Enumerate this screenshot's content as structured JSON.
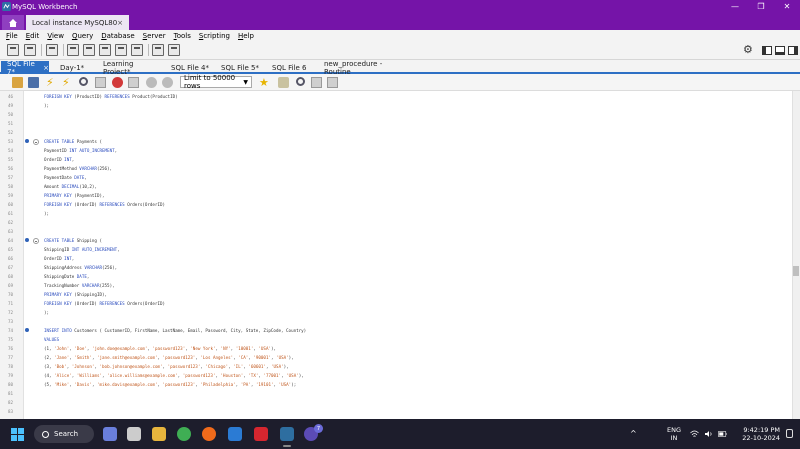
{
  "window": {
    "title": "MySQL Workbench",
    "controls": [
      "—",
      "❐",
      "✕"
    ]
  },
  "connection_tab": {
    "label": "Local instance MySQL80",
    "close": "×"
  },
  "menu": [
    "File",
    "Edit",
    "View",
    "Query",
    "Database",
    "Server",
    "Tools",
    "Scripting",
    "Help"
  ],
  "sql_tabs": [
    {
      "label": "SQL File 7*",
      "active": true
    },
    {
      "label": "Day-1*"
    },
    {
      "label": "Learning Project*"
    },
    {
      "label": "SQL File 4*"
    },
    {
      "label": "SQL File 5*"
    },
    {
      "label": "SQL File 6"
    },
    {
      "label": "new_procedure - Routine"
    }
  ],
  "editor_toolbar": {
    "limit_select": "Limit to 50000 rows"
  },
  "editor": {
    "lines": [
      {
        "n": "46",
        "code": "FOREIGN KEY (ProductID) REFERENCES Product(ProductID)"
      },
      {
        "n": "49",
        "code": ");"
      },
      {
        "n": "50",
        "code": ""
      },
      {
        "n": "51",
        "code": ""
      },
      {
        "n": "52",
        "code": ""
      },
      {
        "n": "53",
        "code": "CREATE TABLE Payments (",
        "marker": true,
        "fold": true
      },
      {
        "n": "54",
        "code": "PaymentID INT AUTO_INCREMENT,"
      },
      {
        "n": "55",
        "code": "OrderID INT,"
      },
      {
        "n": "56",
        "code": "PaymentMethod VARCHAR(256),"
      },
      {
        "n": "57",
        "code": "PaymentDate DATE,"
      },
      {
        "n": "58",
        "code": "Amount DECIMAL(10,2),"
      },
      {
        "n": "59",
        "code": "PRIMARY KEY (PaymentID),"
      },
      {
        "n": "60",
        "code": "FOREIGN KEY (OrderID) REFERENCES Orders(OrderID)"
      },
      {
        "n": "61",
        "code": ");"
      },
      {
        "n": "62",
        "code": ""
      },
      {
        "n": "63",
        "code": ""
      },
      {
        "n": "64",
        "code": "CREATE TABLE Shipping (",
        "marker": true,
        "fold": true
      },
      {
        "n": "65",
        "code": "ShippingID INT AUTO_INCREMENT,"
      },
      {
        "n": "66",
        "code": "OrderID INT,"
      },
      {
        "n": "67",
        "code": "ShippingAddress VARCHAR(256),"
      },
      {
        "n": "68",
        "code": "ShippingDate DATE,"
      },
      {
        "n": "69",
        "code": "TrackingNumber VARCHAR(255),"
      },
      {
        "n": "70",
        "code": "PRIMARY KEY (ShippingID),"
      },
      {
        "n": "71",
        "code": "FOREIGN KEY (OrderID) REFERENCES Orders(OrderID)"
      },
      {
        "n": "72",
        "code": ");"
      },
      {
        "n": "73",
        "code": ""
      },
      {
        "n": "74",
        "code": "INSERT INTO Customers ( CustomerID, FirstName, LastName, Email, Password, City, State, ZipCode, Country)",
        "marker": true
      },
      {
        "n": "75",
        "code": "VALUES"
      },
      {
        "n": "76",
        "code": "(1, 'John', 'Doe', 'john.doe@example.com', 'password123', 'New York', 'NY', '10001', 'USA'),"
      },
      {
        "n": "77",
        "code": "(2, 'Jane', 'Smith', 'jane.smith@example.com', 'password123', 'Los Angeles', 'CA', '90001', 'USA'),"
      },
      {
        "n": "78",
        "code": "(3, 'Bob', 'Johnson', 'bob.johnson@example.com', 'password123', 'Chicago', 'IL', '60601', 'USA'),"
      },
      {
        "n": "79",
        "code": "(4, 'Alice', 'Williams', 'alice.williams@example.com', 'password123', 'Houston', 'TX', '77001', 'USA'),"
      },
      {
        "n": "80",
        "code": "(5, 'Mike', 'Davis', 'mike.davis@example.com', 'password123', 'Philadelphia', 'PA', '19101', 'USA');"
      },
      {
        "n": "81",
        "code": ""
      },
      {
        "n": "82",
        "code": ""
      },
      {
        "n": "83",
        "code": ""
      }
    ]
  },
  "taskbar": {
    "search": "Search",
    "badge": "7",
    "lang_line1": "ENG",
    "lang_line2": "IN",
    "time": "9:42:19 PM",
    "date": "22-10-2024"
  },
  "colors": {
    "titlebar": "#7514a8",
    "active_tab": "#2d6fc4",
    "keyword": "#2a4bbd",
    "string": "#c0561b"
  }
}
